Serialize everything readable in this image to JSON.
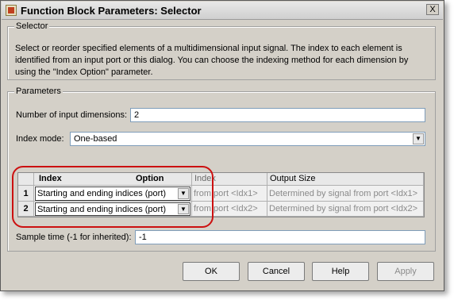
{
  "window": {
    "title": "Function Block Parameters: Selector",
    "close_label": "X"
  },
  "selector": {
    "legend": "Selector",
    "description": "Select or reorder specified elements of a multidimensional input signal. The index to each element is identified from an input port or this dialog. You can choose the indexing method for each dimension by using the \"Index Option\" parameter."
  },
  "parameters": {
    "legend": "Parameters",
    "num_dims_label": "Number of input dimensions:",
    "num_dims_value": "2",
    "index_mode_label": "Index mode:",
    "index_mode_value": "One-based",
    "table": {
      "headers": [
        "Index",
        "Option",
        "Index",
        "Output Size"
      ],
      "rows": [
        {
          "num": "1",
          "option": "Starting and ending indices (port)",
          "index": "from port <Idx1>",
          "output_size": "Determined by signal from port <Idx1>"
        },
        {
          "num": "2",
          "option": "Starting and ending indices (port)",
          "index": "from port <Idx2>",
          "output_size": "Determined by signal from port <Idx2>"
        }
      ]
    },
    "sample_time_label": "Sample time (-1 for inherited):",
    "sample_time_value": "-1"
  },
  "buttons": {
    "ok": "OK",
    "cancel": "Cancel",
    "help": "Help",
    "apply": "Apply"
  },
  "colors": {
    "dialog_bg": "#d4d0c8",
    "highlight": "#cc1010",
    "disabled_text": "#8a8a8a"
  }
}
